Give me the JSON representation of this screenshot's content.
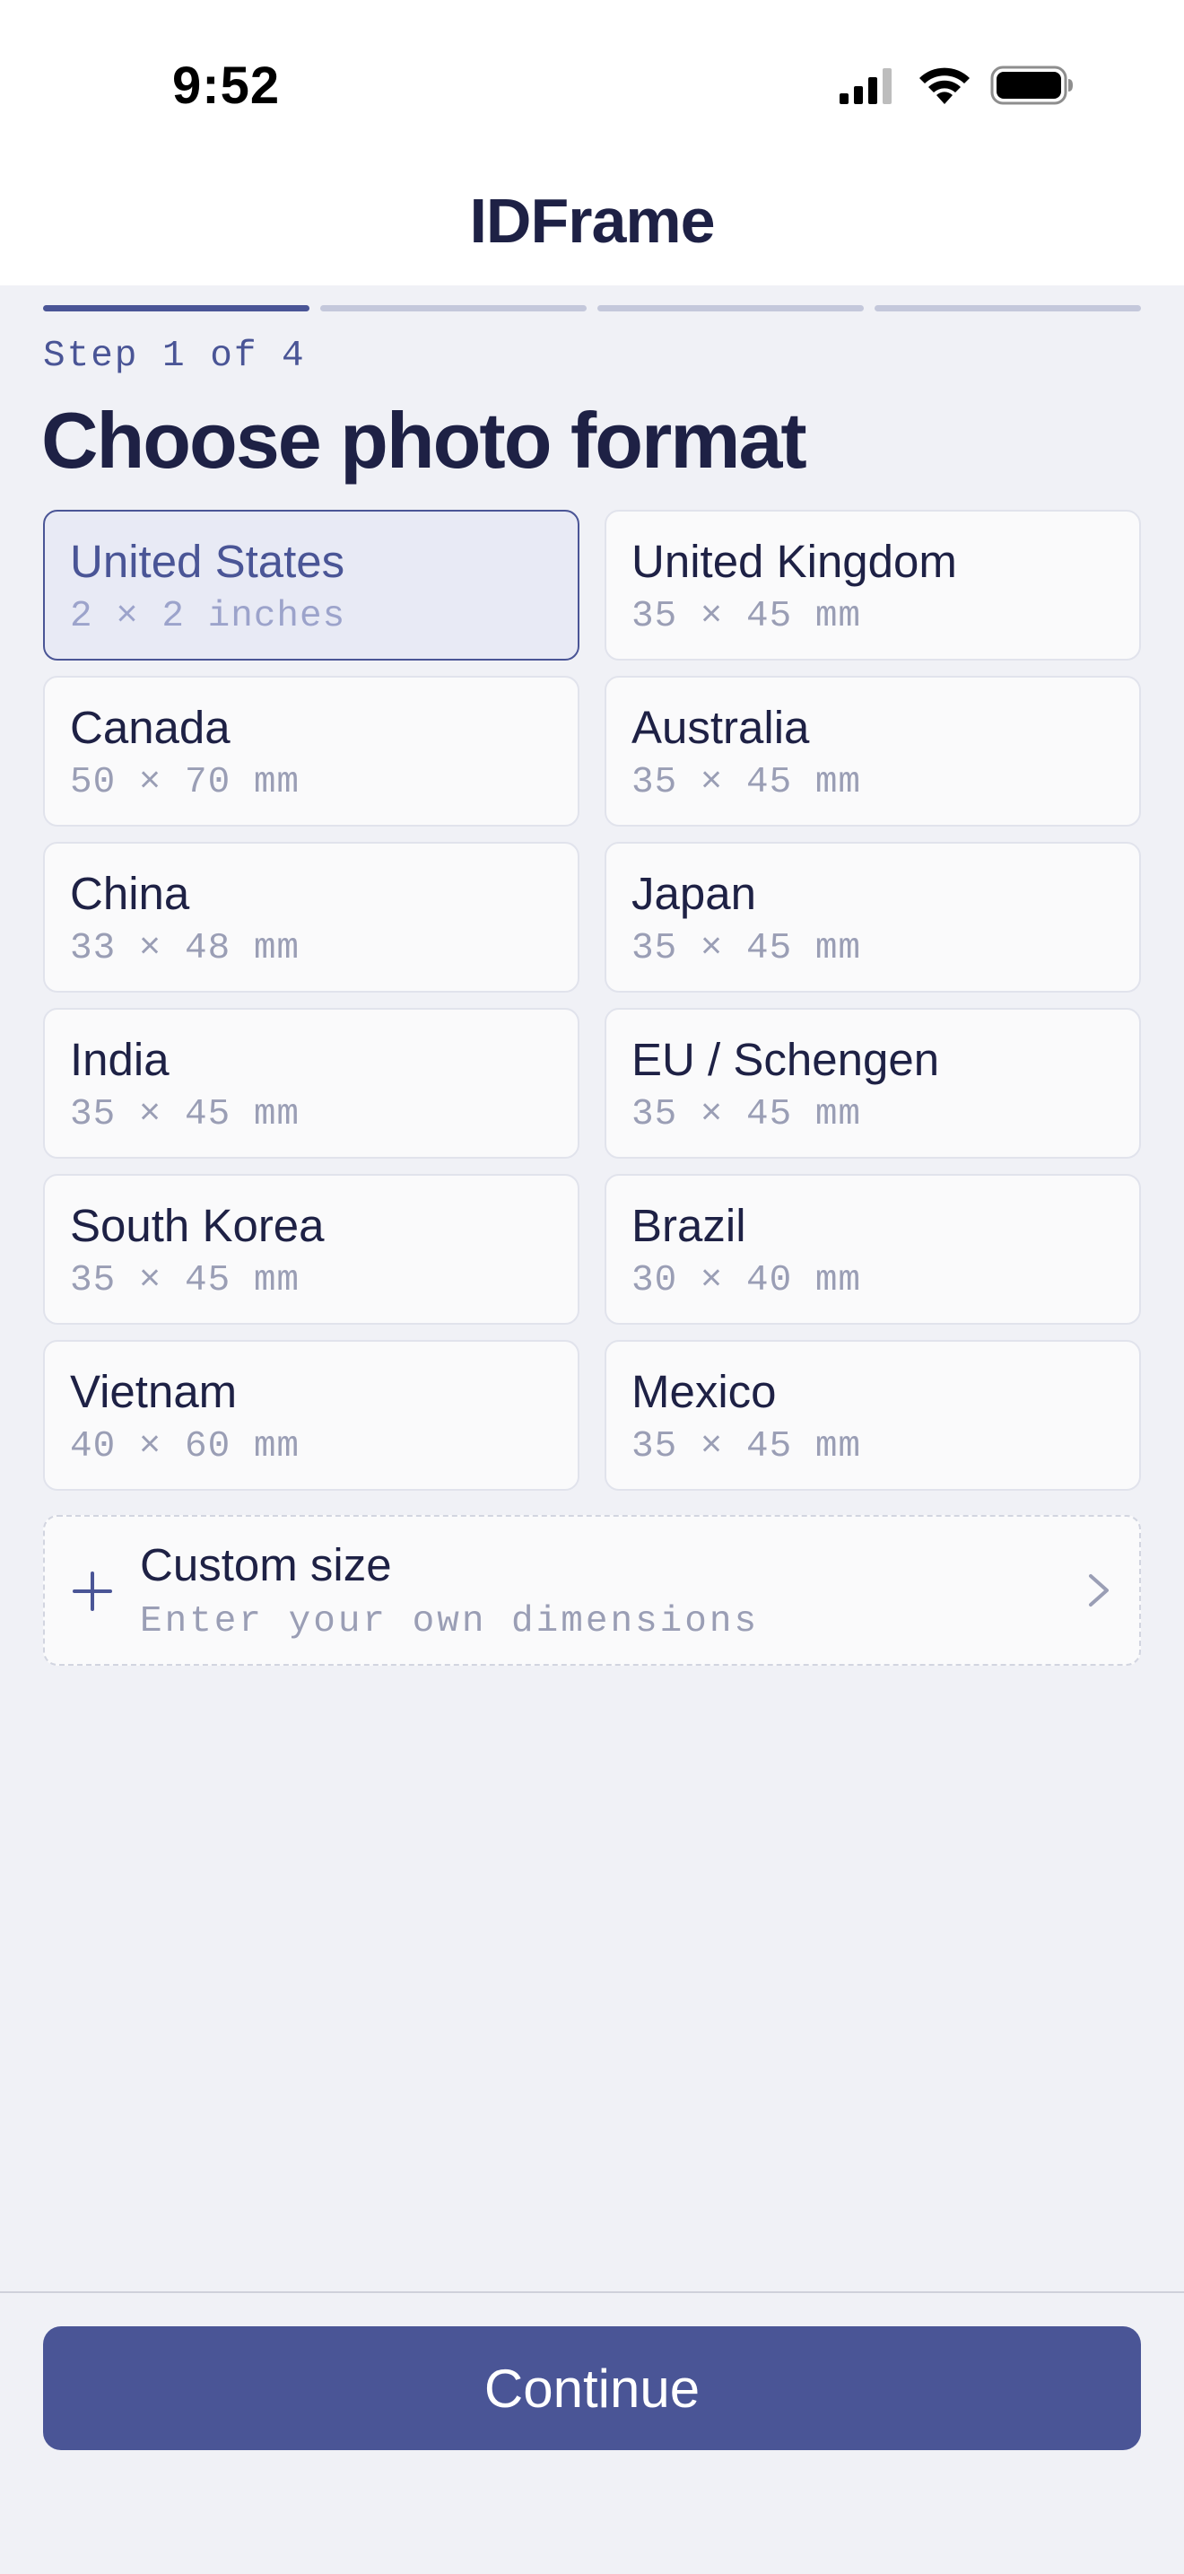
{
  "status_bar": {
    "time": "9:52"
  },
  "nav": {
    "title": "IDFrame"
  },
  "progress": {
    "current_step": 1,
    "total_steps": 4
  },
  "step_label": "Step 1 of 4",
  "page_title": "Choose photo format",
  "formats": [
    {
      "name": "United States",
      "size": "2 × 2 inches",
      "selected": true
    },
    {
      "name": "United Kingdom",
      "size": "35 × 45 mm",
      "selected": false
    },
    {
      "name": "Canada",
      "size": "50 × 70 mm",
      "selected": false
    },
    {
      "name": "Australia",
      "size": "35 × 45 mm",
      "selected": false
    },
    {
      "name": "China",
      "size": "33 × 48 mm",
      "selected": false
    },
    {
      "name": "Japan",
      "size": "35 × 45 mm",
      "selected": false
    },
    {
      "name": "India",
      "size": "35 × 45 mm",
      "selected": false
    },
    {
      "name": "EU / Schengen",
      "size": "35 × 45 mm",
      "selected": false
    },
    {
      "name": "South Korea",
      "size": "35 × 45 mm",
      "selected": false
    },
    {
      "name": "Brazil",
      "size": "30 × 40 mm",
      "selected": false
    },
    {
      "name": "Vietnam",
      "size": "40 × 60 mm",
      "selected": false
    },
    {
      "name": "Mexico",
      "size": "35 × 45 mm",
      "selected": false
    }
  ],
  "custom": {
    "title": "Custom size",
    "subtitle": "Enter your own dimensions",
    "icon": "plus-icon",
    "trailing_icon": "chevron-right-icon"
  },
  "continue_label": "Continue",
  "colors": {
    "accent": "#4A5596",
    "background": "#F0F1F6",
    "text": "#1E2145",
    "muted": "#9A9EB5",
    "selected_bg": "#E8EAF5"
  }
}
